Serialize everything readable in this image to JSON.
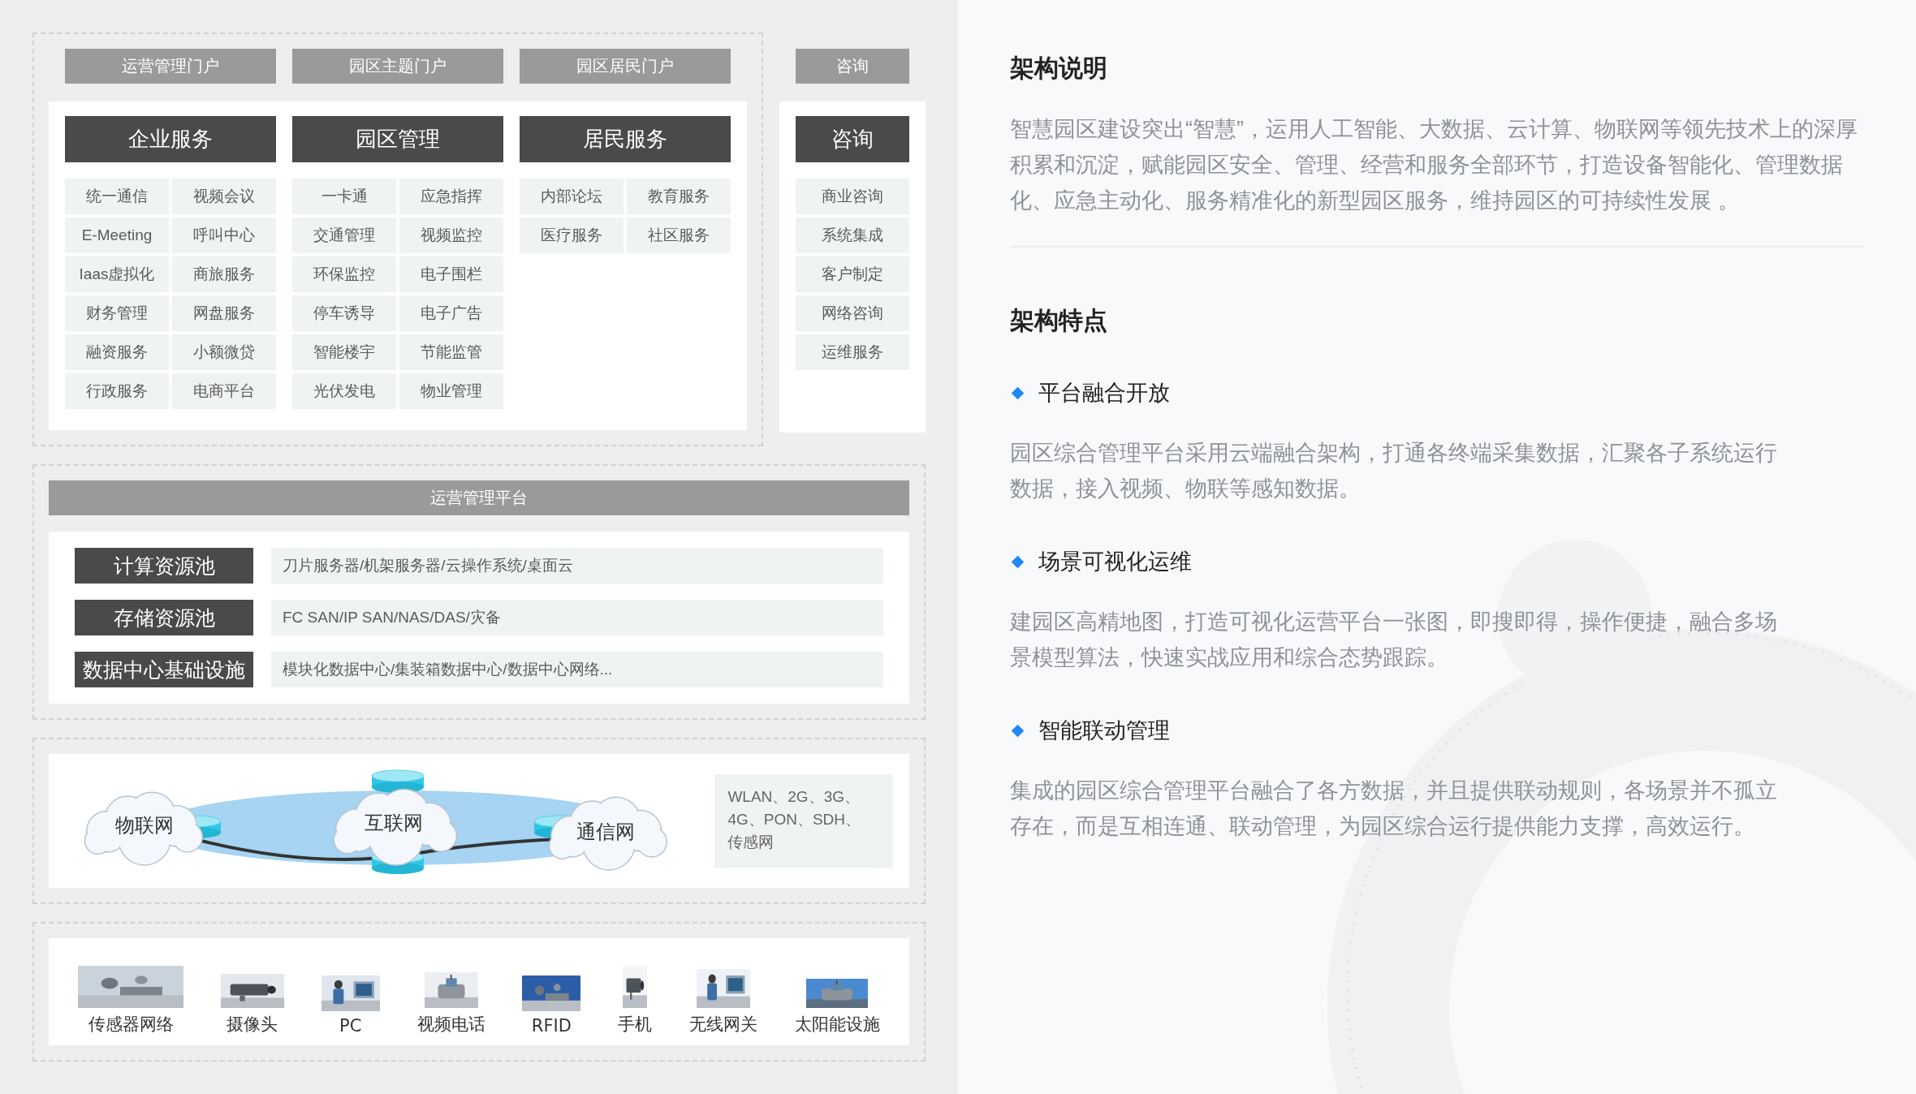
{
  "portals": {
    "items": [
      "运营管理门户",
      "园区主题门户",
      "园区居民门户"
    ],
    "consult": "咨询"
  },
  "services": [
    {
      "title": "企业服务",
      "items": [
        "统一通信",
        "视频会议",
        "E-Meeting",
        "呼叫中心",
        "Iaas虚拟化",
        "商旅服务",
        "财务管理",
        "网盘服务",
        "融资服务",
        "小额微贷",
        "行政服务",
        "电商平台"
      ]
    },
    {
      "title": "园区管理",
      "items": [
        "一卡通",
        "应急指挥",
        "交通管理",
        "视频监控",
        "环保监控",
        "电子围栏",
        "停车诱导",
        "电子广告",
        "智能楼宇",
        "节能监管",
        "光伏发电",
        "物业管理"
      ]
    },
    {
      "title": "居民服务",
      "items": [
        "内部论坛",
        "教育服务",
        "医疗服务",
        "社区服务"
      ]
    }
  ],
  "consult": {
    "title": "咨询",
    "items": [
      "商业咨询",
      "系统集成",
      "客户制定",
      "网络咨询",
      "运维服务"
    ]
  },
  "platform": {
    "title": "运营管理平台",
    "rows": [
      {
        "label": "计算资源池",
        "value": "刀片服务器/机架服务器/云操作系统/桌面云"
      },
      {
        "label": "存储资源池",
        "value": "FC SAN/IP SAN/NAS/DAS/灾备"
      },
      {
        "label": "数据中心基础设施",
        "value": "模块化数据中心/集装箱数据中心/数据中心网络..."
      }
    ]
  },
  "network": {
    "labels": [
      "物联网",
      "互联网",
      "通信网"
    ],
    "note_lines": [
      "WLAN、2G、3G、",
      "4G、PON、SDH、",
      "传感网"
    ]
  },
  "devices": [
    "传感器网络",
    "摄像头",
    "PC",
    "视频电话",
    "RFID",
    "手机",
    "无线网关",
    "太阳能设施"
  ],
  "description": {
    "title": "架构说明",
    "text": "智慧园区建设突出“智慧”，运用人工智能、大数据、云计算、物联网等领先技术上的深厚积累和沉淀，赋能园区安全、管理、经营和服务全部环节，打造设备智能化、管理数据化、应急主动化、服务精准化的新型园区服务，维持园区的可持续性发展 。"
  },
  "features": {
    "title": "架构特点",
    "items": [
      {
        "title": "平台融合开放",
        "text": "园区综合管理平台采用云端融合架构，打通各终端采集数据，汇聚各子系统运行数据，接入视频、物联等感知数据。"
      },
      {
        "title": "场景可视化运维",
        "text": "建园区高精地图，打造可视化运营平台一张图，即搜即得，操作便捷，融合多场景模型算法，快速实战应用和综合态势跟踪。"
      },
      {
        "title": "智能联动管理",
        "text": "集成的园区综合管理平台融合了各方数据，并且提供联动规则，各场景并不孤立存在，而是互相连通、联动管理，为园区综合运行提供能力支撑，高效运行。"
      }
    ]
  }
}
